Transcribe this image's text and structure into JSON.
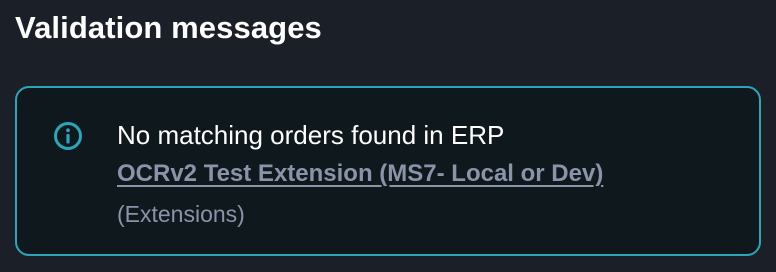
{
  "section": {
    "title": "Validation messages"
  },
  "message": {
    "icon": "info-icon",
    "text": "No matching orders found in ERP",
    "source_link": "OCRv2 Test Extension (MS7- Local or Dev)",
    "source_category": "(Extensions)"
  },
  "colors": {
    "background": "#1b1f27",
    "panel_background": "#0f181d",
    "accent": "#2aa6b8",
    "text_primary": "#ffffff",
    "text_secondary": "#8a93a8"
  }
}
